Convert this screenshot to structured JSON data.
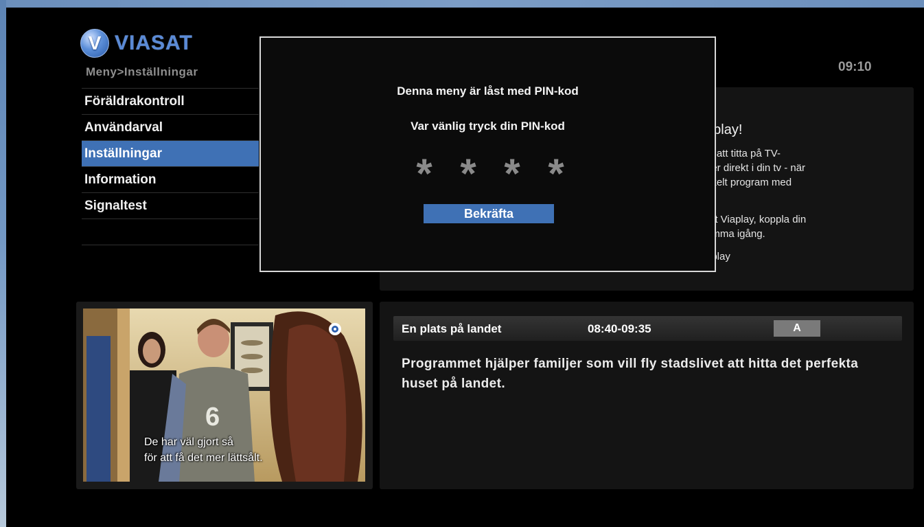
{
  "brand": {
    "logo_letter": "V",
    "name": "VIASAT"
  },
  "breadcrumb": "Meny>Inställningar",
  "clock": "09:10",
  "menu": {
    "items": [
      {
        "label": "Föräldrakontroll",
        "selected": false
      },
      {
        "label": "Användarval",
        "selected": false
      },
      {
        "label": "Inställningar",
        "selected": true
      },
      {
        "label": "Information",
        "selected": false
      },
      {
        "label": "Signaltest",
        "selected": false
      }
    ]
  },
  "info_panel": {
    "title": "aplay!",
    "lines": [
      "ja att titta på TV-",
      "ner direkt i din tv - när",
      "nkelt program med",
      "rat Viaplay, koppla din",
      "omma igång.",
      "aplay"
    ]
  },
  "pin_dialog": {
    "line1": "Denna meny är låst med PIN-kod",
    "line2": "Var vänlig tryck din PIN-kod",
    "digits": [
      "*",
      "*",
      "*",
      "*"
    ],
    "confirm_label": "Bekräfta"
  },
  "video": {
    "subtitle_line1": "De har väl gjort så",
    "subtitle_line2": "för att få det mer lättsålt."
  },
  "program": {
    "title": "En plats på landet",
    "time": "08:40-09:35",
    "rating": "A",
    "description": "Programmet hjälper familjer som vill fly stadslivet att hitta det perfekta huset på landet."
  },
  "colors": {
    "accent": "#3f71b5",
    "background": "#000000"
  }
}
